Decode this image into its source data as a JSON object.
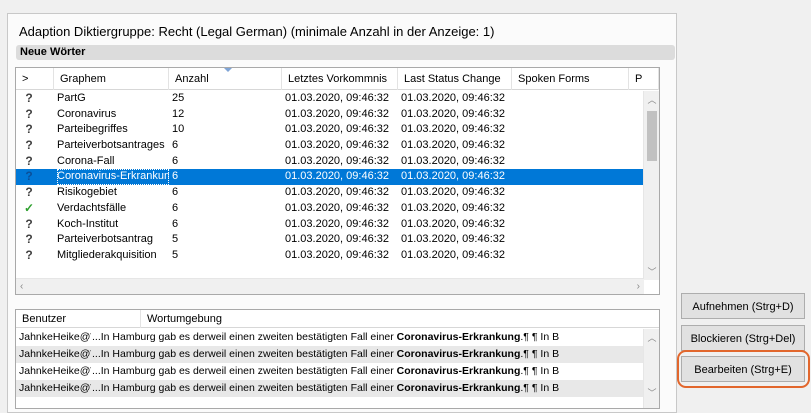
{
  "dialog": {
    "title": "Adaption Diktiergruppe: Recht (Legal German) (minimale Anzahl in der Anzeige: 1)",
    "section_label": "Neue Wörter"
  },
  "words_table": {
    "columns": [
      ">",
      "Graphem",
      "Anzahl",
      "Letztes Vorkommnis",
      "Last Status Change",
      "Spoken Forms",
      "P"
    ],
    "rows": [
      {
        "icon": "question-icon",
        "glyph": "?",
        "graphem": "PartG",
        "anzahl": "25",
        "letztes": "01.03.2020, 09:46:32",
        "status": "01.03.2020, 09:46:32",
        "selected": false
      },
      {
        "icon": "question-icon",
        "glyph": "?",
        "graphem": "Coronavirus",
        "anzahl": "12",
        "letztes": "01.03.2020, 09:46:32",
        "status": "01.03.2020, 09:46:32",
        "selected": false
      },
      {
        "icon": "question-icon",
        "glyph": "?",
        "graphem": "Parteibegriffes",
        "anzahl": "10",
        "letztes": "01.03.2020, 09:46:32",
        "status": "01.03.2020, 09:46:32",
        "selected": false
      },
      {
        "icon": "question-icon",
        "glyph": "?",
        "graphem": "Parteiverbotsantrages",
        "anzahl": "6",
        "letztes": "01.03.2020, 09:46:32",
        "status": "01.03.2020, 09:46:32",
        "selected": false
      },
      {
        "icon": "question-icon",
        "glyph": "?",
        "graphem": "Corona-Fall",
        "anzahl": "6",
        "letztes": "01.03.2020, 09:46:32",
        "status": "01.03.2020, 09:46:32",
        "selected": false
      },
      {
        "icon": "question-icon",
        "glyph": "?",
        "graphem": "Coronavirus-Erkrankung",
        "anzahl": "6",
        "letztes": "01.03.2020, 09:46:32",
        "status": "01.03.2020, 09:46:32",
        "selected": true
      },
      {
        "icon": "question-icon",
        "glyph": "?",
        "graphem": "Risikogebiet",
        "anzahl": "6",
        "letztes": "01.03.2020, 09:46:32",
        "status": "01.03.2020, 09:46:32",
        "selected": false
      },
      {
        "icon": "check-icon",
        "glyph": "✓",
        "graphem": "Verdachtsfälle",
        "anzahl": "6",
        "letztes": "01.03.2020, 09:46:32",
        "status": "01.03.2020, 09:46:32",
        "selected": false
      },
      {
        "icon": "question-icon",
        "glyph": "?",
        "graphem": "Koch-Institut",
        "anzahl": "6",
        "letztes": "01.03.2020, 09:46:32",
        "status": "01.03.2020, 09:46:32",
        "selected": false
      },
      {
        "icon": "question-icon",
        "glyph": "?",
        "graphem": "Parteiverbotsantrag",
        "anzahl": "5",
        "letztes": "01.03.2020, 09:46:32",
        "status": "01.03.2020, 09:46:32",
        "selected": false
      },
      {
        "icon": "question-icon",
        "glyph": "?",
        "graphem": "Mitgliederakquisition",
        "anzahl": "5",
        "letztes": "01.03.2020, 09:46:32",
        "status": "01.03.2020, 09:46:32",
        "selected": false
      }
    ]
  },
  "context_table": {
    "columns": [
      "Benutzer",
      "Wortumgebung"
    ],
    "rows": [
      {
        "user": "JahnkeHeike@WKD",
        "pre": "...In Hamburg gab es derweil einen zweiten bestätigten Fall einer ",
        "term": "Coronavirus-Erkrankung",
        "post": ".¶ ¶ In B"
      },
      {
        "user": "JahnkeHeike@WKD",
        "pre": "...In Hamburg gab es derweil einen zweiten bestätigten Fall einer ",
        "term": "Coronavirus-Erkrankung",
        "post": ".¶ ¶ In B"
      },
      {
        "user": "JahnkeHeike@WKD",
        "pre": "...In Hamburg gab es derweil einen zweiten bestätigten Fall einer ",
        "term": "Coronavirus-Erkrankung",
        "post": ".¶ ¶ In B"
      },
      {
        "user": "JahnkeHeike@WKD",
        "pre": "...In Hamburg gab es derweil einen zweiten bestätigten Fall einer ",
        "term": "Coronavirus-Erkrankung",
        "post": ".¶ ¶ In B"
      }
    ]
  },
  "buttons": {
    "add": "Aufnehmen (Strg+D)",
    "block": "Blockieren (Strg+Del)",
    "edit": "Bearbeiten (Strg+E)"
  },
  "colors": {
    "selection": "#0078d7",
    "highlight_ring": "#e2672d",
    "check": "#2ea02e"
  }
}
